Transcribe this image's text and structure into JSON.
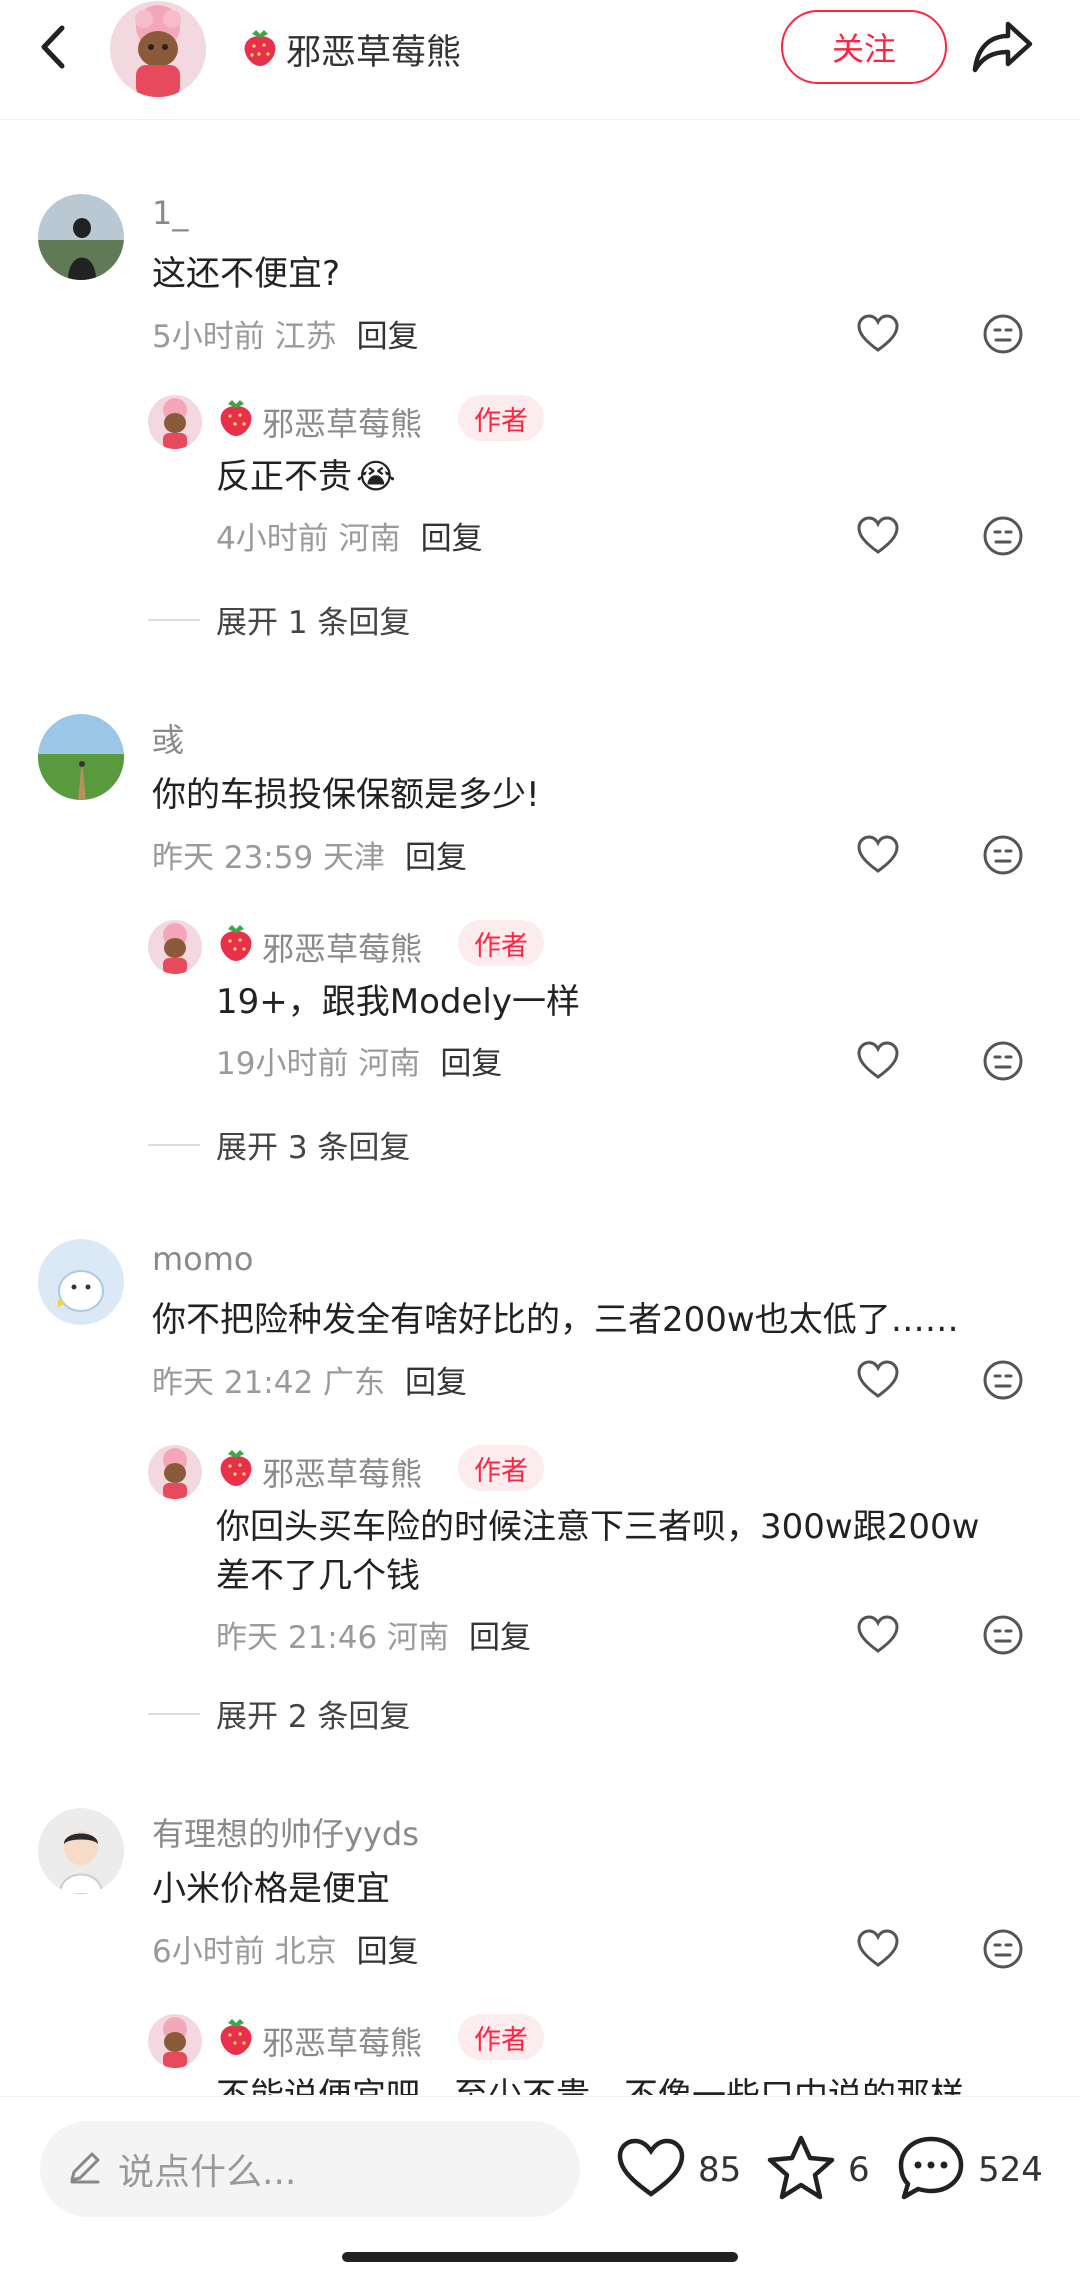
{
  "header": {
    "author_name": "邪恶草莓熊",
    "follow_label": "关注"
  },
  "comments": [
    {
      "user": "1_",
      "text": "这还不便宜?",
      "time_loc": "5小时前 江苏",
      "reply_label": "回复",
      "reply": {
        "user": "邪恶草莓熊",
        "tag": "作者",
        "text": "反正不贵",
        "emoji": "😭",
        "time_loc": "4小时前 河南",
        "reply_label": "回复"
      },
      "expand": "展开 1 条回复"
    },
    {
      "user": "彧",
      "text": "你的车损投保保额是多少!",
      "time_loc": "昨天 23:59 天津",
      "reply_label": "回复",
      "reply": {
        "user": "邪恶草莓熊",
        "tag": "作者",
        "text": "19+，跟我Modely一样",
        "time_loc": "19小时前 河南",
        "reply_label": "回复"
      },
      "expand": "展开 3 条回复"
    },
    {
      "user": "momo",
      "text": "你不把险种发全有啥好比的，三者200w也太低了……",
      "time_loc": "昨天 21:42 广东",
      "reply_label": "回复",
      "reply": {
        "user": "邪恶草莓熊",
        "tag": "作者",
        "text_line1": "你回头买车险的时候注意下三者呗，300w跟200w",
        "text_line2": "差不了几个钱",
        "time_loc": "昨天 21:46 河南",
        "reply_label": "回复"
      },
      "expand": "展开 2 条回复"
    },
    {
      "user": "有理想的帅仔yyds",
      "text": "小米价格是便宜",
      "time_loc": "6小时前 北京",
      "reply_label": "回复",
      "reply": {
        "user": "邪恶草莓熊",
        "tag": "作者",
        "text": "不能说便宜吧，至少不贵，不像一些口中说的那样"
      }
    }
  ],
  "bottom": {
    "input_placeholder": "说点什么...",
    "likes": "85",
    "stars": "6",
    "comments": "524"
  },
  "colors": {
    "accent": "#ff2442",
    "author_tag_bg": "#fdecee"
  },
  "icons": [
    "back-arrow-icon",
    "share-icon",
    "heart-icon",
    "emoji-face-icon",
    "pencil-icon",
    "star-icon",
    "comment-bubble-icon",
    "strawberry-icon"
  ]
}
